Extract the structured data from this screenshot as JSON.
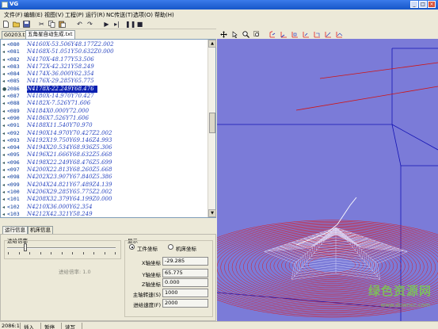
{
  "title": "VG",
  "menu": [
    "文件(F)",
    "编辑(E)",
    "视图(V)",
    "工程(P)",
    "运行(R)",
    "NC传送(T)",
    "选项(O)",
    "帮助(H)"
  ],
  "file_tabs": [
    "G0203.txt",
    "五角星自动生成.txt"
  ],
  "code_lines": [
    {
      "lno": "<080",
      "code": "N4160X-53.506Y48.177Z2.002"
    },
    {
      "lno": "<081",
      "code": "N4168X-51.051Y50.632Z0.000"
    },
    {
      "lno": "<082",
      "code": "N4170X-48.177Y53.506"
    },
    {
      "lno": "<083",
      "code": "N4172X-42.321Y58.249"
    },
    {
      "lno": "<084",
      "code": "N4174X-36.000Y62.354"
    },
    {
      "lno": "<085",
      "code": "N4176X-29.285Y65.775"
    },
    {
      "lno": "2086",
      "code": "N4178X-22.249Y68.476",
      "selected": true
    },
    {
      "lno": "<087",
      "code": "N4180X-14.970Y70.427"
    },
    {
      "lno": "<088",
      "code": "N4182X-7.526Y71.606"
    },
    {
      "lno": "<089",
      "code": "N4184X0.000Y72.000"
    },
    {
      "lno": "<090",
      "code": "N4186X7.526Y71.606"
    },
    {
      "lno": "<091",
      "code": "N4188X11.540Y70.970"
    },
    {
      "lno": "<092",
      "code": "N4190X14.970Y70.427Z2.002"
    },
    {
      "lno": "<093",
      "code": "N4192X19.750Y69.146Z4.993"
    },
    {
      "lno": "<094",
      "code": "N4194X20.534Y68.936Z5.306"
    },
    {
      "lno": "<095",
      "code": "N4196X21.666Y68.632Z5.668"
    },
    {
      "lno": "<096",
      "code": "N4198X22.249Y68.476Z5.699"
    },
    {
      "lno": "<097",
      "code": "N4200X22.813Y68.260Z5.668"
    },
    {
      "lno": "<098",
      "code": "N4202X23.907Y67.840Z5.386"
    },
    {
      "lno": "<099",
      "code": "N4204X24.821Y67.489Z4.139"
    },
    {
      "lno": "<100",
      "code": "N4206X29.285Y65.775Z2.002"
    },
    {
      "lno": "<101",
      "code": "N4208X32.379Y64.199Z0.000"
    },
    {
      "lno": "<102",
      "code": "N4210X36.000Y62.354"
    },
    {
      "lno": "<103",
      "code": "N4212X42.321Y58.249"
    }
  ],
  "bottom_tabs": [
    "运行信息",
    "机床信息"
  ],
  "feed_rate": {
    "label": "进给倍率",
    "value_text": "进给倍率: 1.0",
    "level": 0.15
  },
  "display": {
    "group_label": "显示",
    "coord_options": [
      "工件坐标",
      "机床坐标"
    ],
    "selected_coord": "工件坐标",
    "fields": [
      {
        "label": "X轴坐标",
        "value": "-29.285"
      },
      {
        "label": "Y轴坐标",
        "value": "65.775"
      },
      {
        "label": "Z轴坐标",
        "value": "0.000"
      },
      {
        "label": "主轴转速(S)",
        "value": "1000"
      },
      {
        "label": "进给速度(F)",
        "value": "2000"
      }
    ]
  },
  "status": {
    "line": "2086:1",
    "mode": "插入",
    "state": "暂停",
    "access": "读写"
  },
  "watermark": {
    "text": "绿色资源网",
    "url": "www.downcc.com"
  },
  "colors": {
    "viewport_bg": "#7b7bd8",
    "toolpath": "#e01818",
    "surface": "#e6e6ff",
    "selection": "#0a1fb0",
    "code_text": "#2b47c0"
  },
  "icons": {
    "toolbar": [
      "new-file-icon",
      "open-folder-icon",
      "save-icon",
      "cut-icon",
      "copy-icon",
      "paste-icon",
      "undo-icon",
      "redo-icon",
      "run-icon",
      "step-icon",
      "pause-icon",
      "stop-icon"
    ],
    "view_toolbar": [
      "pan-icon",
      "rotate-icon",
      "zoom-icon",
      "zoom-window-icon",
      "view-front-icon",
      "view-back-icon",
      "view-left-icon",
      "view-right-icon",
      "view-top-icon",
      "view-bottom-icon",
      "view-iso-icon"
    ]
  }
}
